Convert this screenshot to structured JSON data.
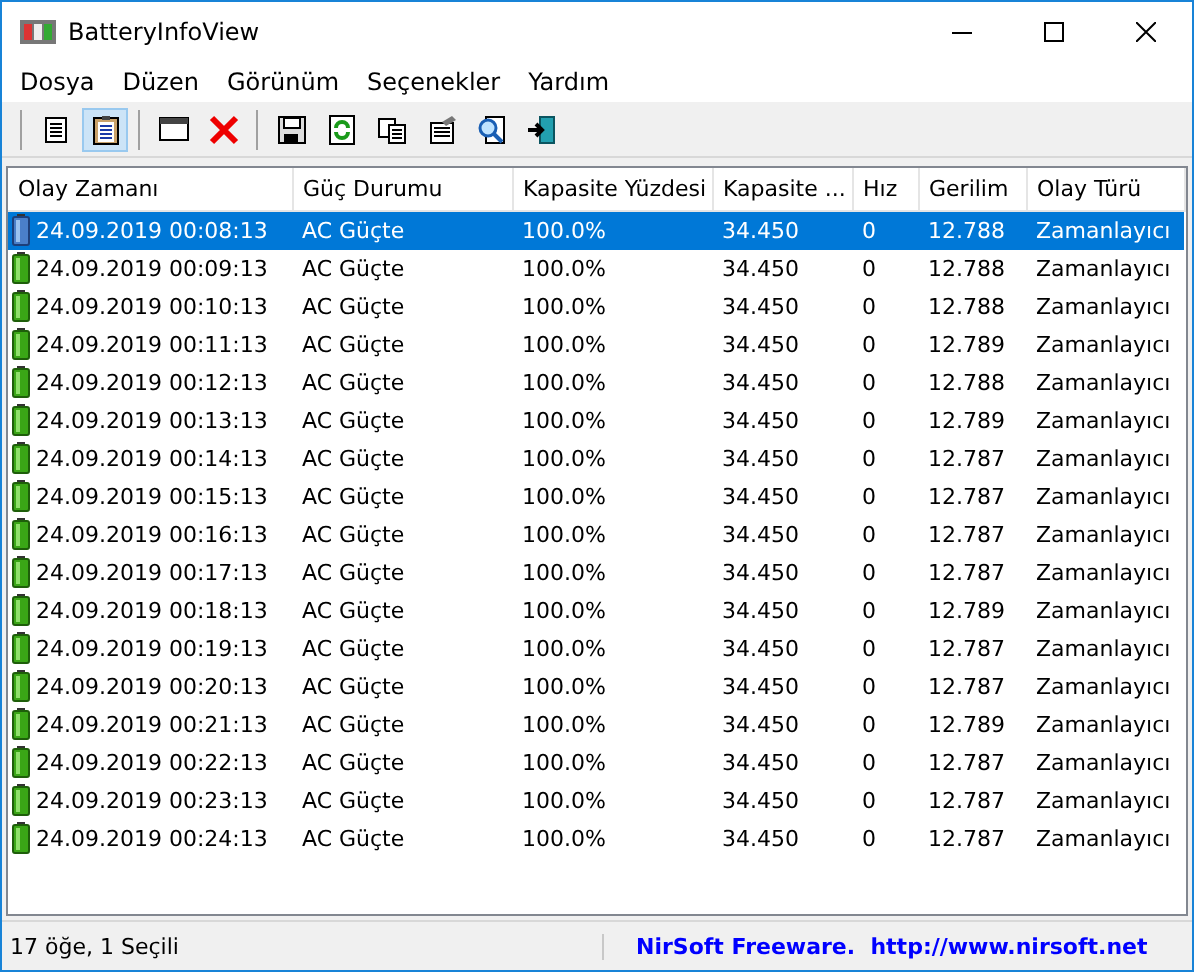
{
  "window": {
    "title": "BatteryInfoView"
  },
  "menu": [
    "Dosya",
    "Düzen",
    "Görünüm",
    "Seçenekler",
    "Yardım"
  ],
  "toolbar": [
    {
      "kind": "properties",
      "pressed": false
    },
    {
      "kind": "clipboard",
      "pressed": true
    },
    {
      "kind": "sep"
    },
    {
      "kind": "window",
      "pressed": false
    },
    {
      "kind": "delete",
      "pressed": false
    },
    {
      "kind": "sep"
    },
    {
      "kind": "save",
      "pressed": false
    },
    {
      "kind": "refresh",
      "pressed": false
    },
    {
      "kind": "copy",
      "pressed": false
    },
    {
      "kind": "report",
      "pressed": false
    },
    {
      "kind": "find",
      "pressed": false
    },
    {
      "kind": "exit",
      "pressed": false
    }
  ],
  "table": {
    "columns": [
      "Olay Zamanı",
      "Güç Durumu",
      "Kapasite Yüzdesi",
      "Kapasite ...",
      "Hız",
      "Gerilim",
      "Olay Türü"
    ],
    "rows": [
      {
        "selected": true,
        "cells": [
          "24.09.2019 00:08:13",
          "AC Güçte",
          "100.0%",
          "34.450",
          "0",
          "12.788",
          "Zamanlayıcı"
        ]
      },
      {
        "selected": false,
        "cells": [
          "24.09.2019 00:09:13",
          "AC Güçte",
          "100.0%",
          "34.450",
          "0",
          "12.788",
          "Zamanlayıcı"
        ]
      },
      {
        "selected": false,
        "cells": [
          "24.09.2019 00:10:13",
          "AC Güçte",
          "100.0%",
          "34.450",
          "0",
          "12.788",
          "Zamanlayıcı"
        ]
      },
      {
        "selected": false,
        "cells": [
          "24.09.2019 00:11:13",
          "AC Güçte",
          "100.0%",
          "34.450",
          "0",
          "12.789",
          "Zamanlayıcı"
        ]
      },
      {
        "selected": false,
        "cells": [
          "24.09.2019 00:12:13",
          "AC Güçte",
          "100.0%",
          "34.450",
          "0",
          "12.788",
          "Zamanlayıcı"
        ]
      },
      {
        "selected": false,
        "cells": [
          "24.09.2019 00:13:13",
          "AC Güçte",
          "100.0%",
          "34.450",
          "0",
          "12.789",
          "Zamanlayıcı"
        ]
      },
      {
        "selected": false,
        "cells": [
          "24.09.2019 00:14:13",
          "AC Güçte",
          "100.0%",
          "34.450",
          "0",
          "12.787",
          "Zamanlayıcı"
        ]
      },
      {
        "selected": false,
        "cells": [
          "24.09.2019 00:15:13",
          "AC Güçte",
          "100.0%",
          "34.450",
          "0",
          "12.787",
          "Zamanlayıcı"
        ]
      },
      {
        "selected": false,
        "cells": [
          "24.09.2019 00:16:13",
          "AC Güçte",
          "100.0%",
          "34.450",
          "0",
          "12.787",
          "Zamanlayıcı"
        ]
      },
      {
        "selected": false,
        "cells": [
          "24.09.2019 00:17:13",
          "AC Güçte",
          "100.0%",
          "34.450",
          "0",
          "12.787",
          "Zamanlayıcı"
        ]
      },
      {
        "selected": false,
        "cells": [
          "24.09.2019 00:18:13",
          "AC Güçte",
          "100.0%",
          "34.450",
          "0",
          "12.789",
          "Zamanlayıcı"
        ]
      },
      {
        "selected": false,
        "cells": [
          "24.09.2019 00:19:13",
          "AC Güçte",
          "100.0%",
          "34.450",
          "0",
          "12.787",
          "Zamanlayıcı"
        ]
      },
      {
        "selected": false,
        "cells": [
          "24.09.2019 00:20:13",
          "AC Güçte",
          "100.0%",
          "34.450",
          "0",
          "12.787",
          "Zamanlayıcı"
        ]
      },
      {
        "selected": false,
        "cells": [
          "24.09.2019 00:21:13",
          "AC Güçte",
          "100.0%",
          "34.450",
          "0",
          "12.789",
          "Zamanlayıcı"
        ]
      },
      {
        "selected": false,
        "cells": [
          "24.09.2019 00:22:13",
          "AC Güçte",
          "100.0%",
          "34.450",
          "0",
          "12.787",
          "Zamanlayıcı"
        ]
      },
      {
        "selected": false,
        "cells": [
          "24.09.2019 00:23:13",
          "AC Güçte",
          "100.0%",
          "34.450",
          "0",
          "12.787",
          "Zamanlayıcı"
        ]
      },
      {
        "selected": false,
        "cells": [
          "24.09.2019 00:24:13",
          "AC Güçte",
          "100.0%",
          "34.450",
          "0",
          "12.787",
          "Zamanlayıcı"
        ]
      }
    ]
  },
  "status_bar": {
    "count": "17 öğe, 1 Seçili",
    "credit": "NirSoft Freeware.  http://www.nirsoft.net"
  }
}
